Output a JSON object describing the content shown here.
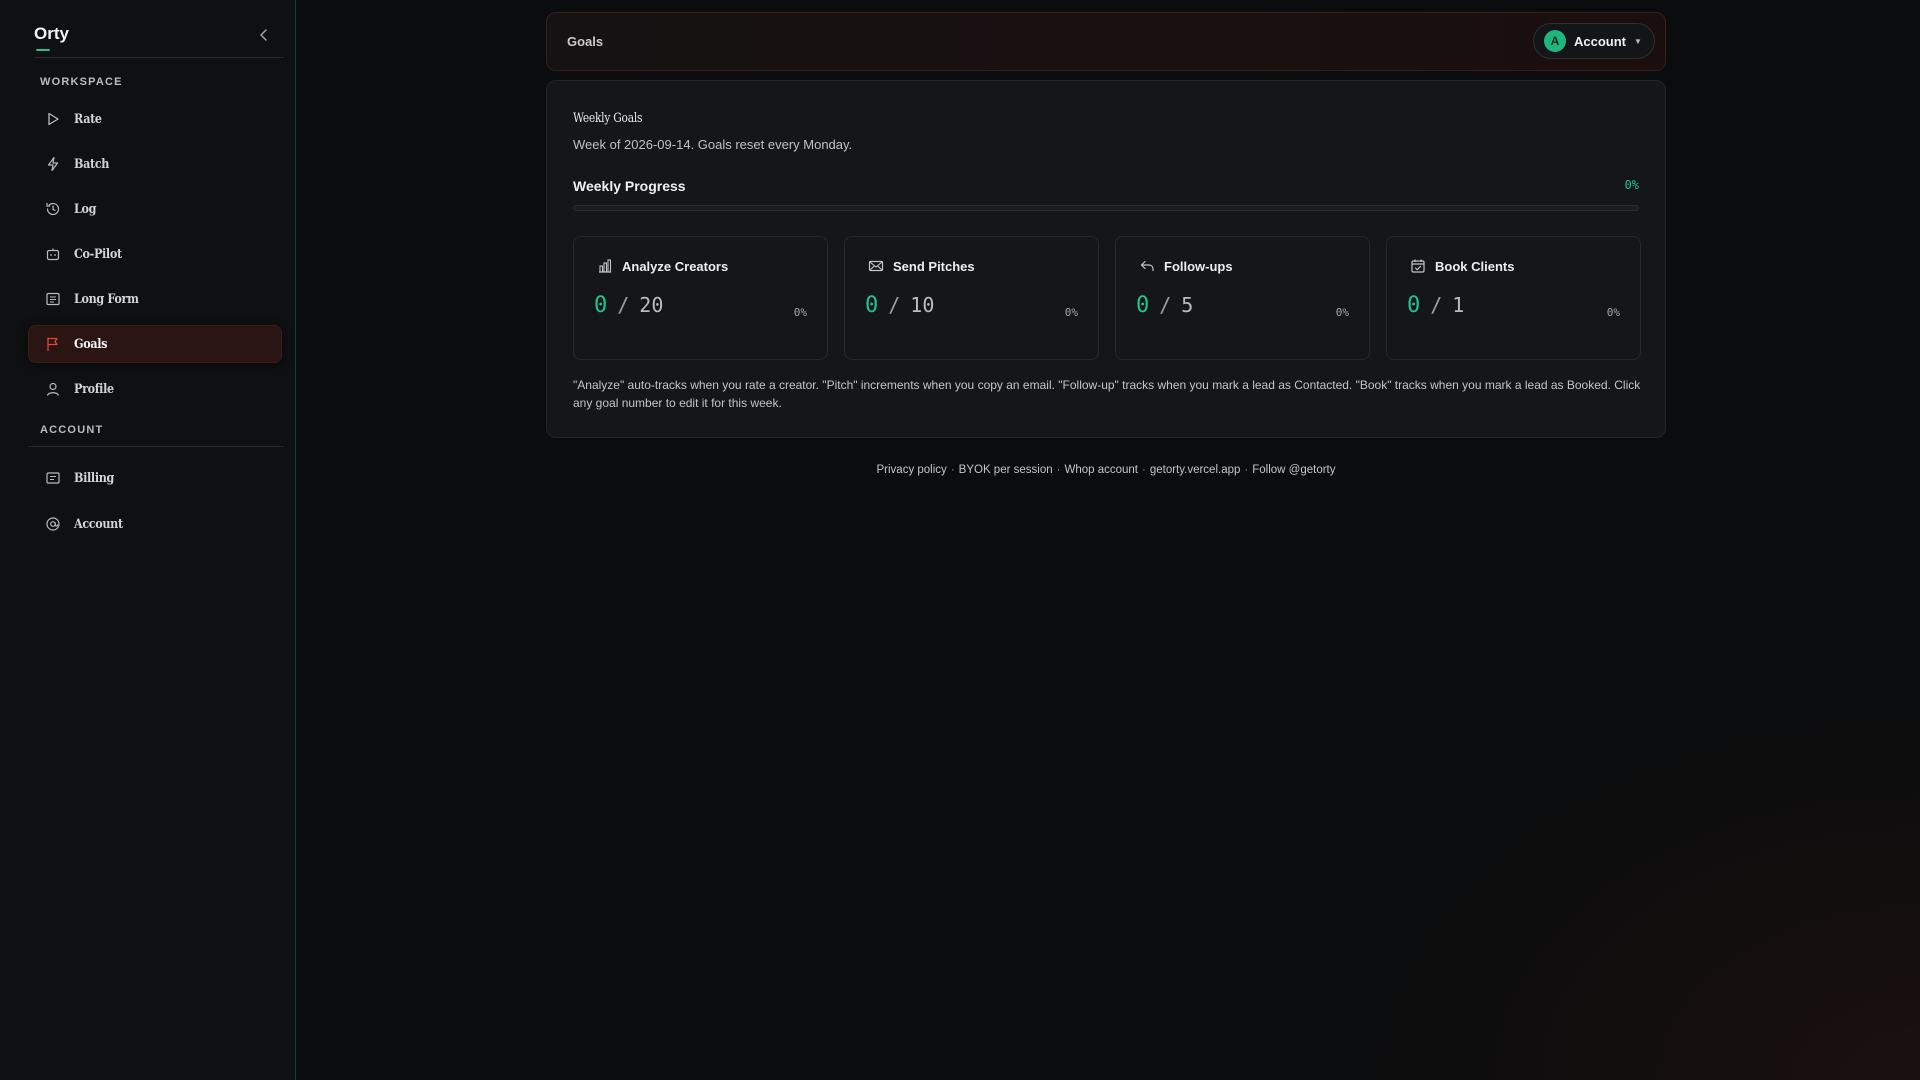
{
  "app": {
    "brand": "Orty"
  },
  "sidebar": {
    "sections": {
      "workspace": "WORKSPACE",
      "account": "ACCOUNT"
    },
    "workspace_items": [
      {
        "label": "Rate",
        "icon": "play-icon"
      },
      {
        "label": "Batch",
        "icon": "lightning-icon"
      },
      {
        "label": "Log",
        "icon": "history-icon"
      },
      {
        "label": "Co-Pilot",
        "icon": "bot-icon"
      },
      {
        "label": "Long Form",
        "icon": "document-icon"
      },
      {
        "label": "Goals",
        "icon": "flag-icon",
        "active": true
      },
      {
        "label": "Profile",
        "icon": "user-icon"
      }
    ],
    "account_items": [
      {
        "label": "Billing",
        "icon": "billing-icon"
      },
      {
        "label": "Account",
        "icon": "at-sign-icon"
      }
    ]
  },
  "topbar": {
    "title": "Goals",
    "account": {
      "avatar_letter": "A",
      "label": "Account"
    }
  },
  "goals_card": {
    "title": "Weekly Goals",
    "subtitle": "Week of 2026-09-14. Goals reset every Monday.",
    "progress_label": "Weekly Progress",
    "progress_pct": "0%",
    "progress_value": 0,
    "goals": [
      {
        "name": "Analyze Creators",
        "icon": "bar-chart-icon",
        "current": "0",
        "target": "20",
        "pct": "0%"
      },
      {
        "name": "Send Pitches",
        "icon": "mail-icon",
        "current": "0",
        "target": "10",
        "pct": "0%"
      },
      {
        "name": "Follow-ups",
        "icon": "reply-icon",
        "current": "0",
        "target": "5",
        "pct": "0%"
      },
      {
        "name": "Book Clients",
        "icon": "calendar-check-icon",
        "current": "0",
        "target": "1",
        "pct": "0%"
      }
    ],
    "note": "\"Analyze\" auto-tracks when you rate a creator. \"Pitch\" increments when you copy an email. \"Follow-up\" tracks when you mark a lead as Contacted. \"Book\" tracks when you mark a lead as Booked. Click any goal number to edit it for this week."
  },
  "footer": {
    "links": [
      "Privacy policy",
      "BYOK per session",
      "Whop account",
      "getorty.vercel.app",
      "Follow @getorty"
    ],
    "separator": "·"
  },
  "colors": {
    "accent": "#22c38e",
    "active_nav_bg": "#2a1513",
    "active_nav_icon": "#e0463a"
  }
}
